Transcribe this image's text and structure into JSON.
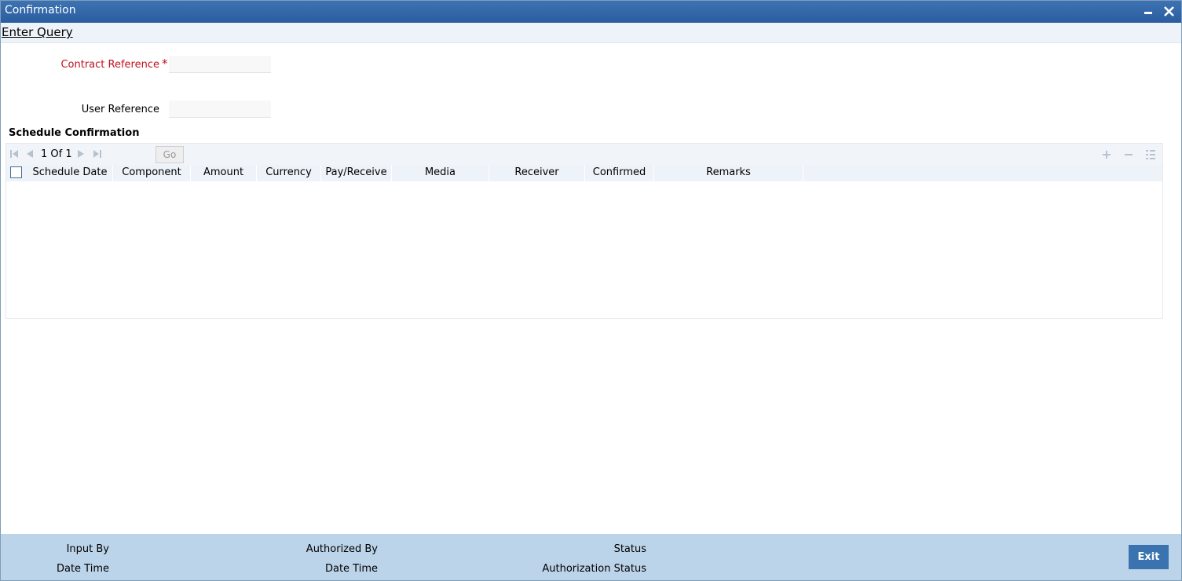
{
  "window": {
    "title": "Confirmation"
  },
  "menu": {
    "enter_query": "Enter Query"
  },
  "form": {
    "contract_reference_label": "Contract Reference",
    "contract_reference_required": "*",
    "contract_reference_value": "",
    "user_reference_label": "User Reference",
    "user_reference_value": ""
  },
  "schedule": {
    "section_title": "Schedule Confirmation",
    "pager_text": "1 Of 1",
    "go_label": "Go",
    "columns": [
      "Schedule Date",
      "Component",
      "Amount",
      "Currency",
      "Pay/Receive",
      "Media",
      "Receiver",
      "Confirmed",
      "Remarks"
    ],
    "rows": []
  },
  "footer": {
    "input_by": "Input By",
    "date_time_1": "Date Time",
    "authorized_by": "Authorized By",
    "date_time_2": "Date Time",
    "status": "Status",
    "authorization_status": "Authorization Status",
    "exit_label": "Exit"
  }
}
